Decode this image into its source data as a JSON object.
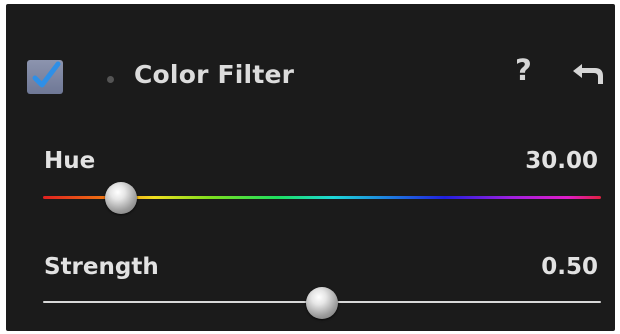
{
  "panel": {
    "title": "Color Filter",
    "enabled": true,
    "icons": {
      "help": "question-mark-icon",
      "reset": "reset-arrow-icon",
      "enable": "checkmark-icon"
    },
    "help_glyph": "?"
  },
  "sliders": {
    "hue": {
      "label": "Hue",
      "value": "30.00",
      "position_fraction": 0.14
    },
    "strength": {
      "label": "Strength",
      "value": "0.50",
      "position_fraction": 0.5
    }
  },
  "colors": {
    "panel_bg": "#1b1b1b",
    "text": "#e2e2e2",
    "checkbox": "#7a82a0",
    "check": "#2f8fe6"
  }
}
